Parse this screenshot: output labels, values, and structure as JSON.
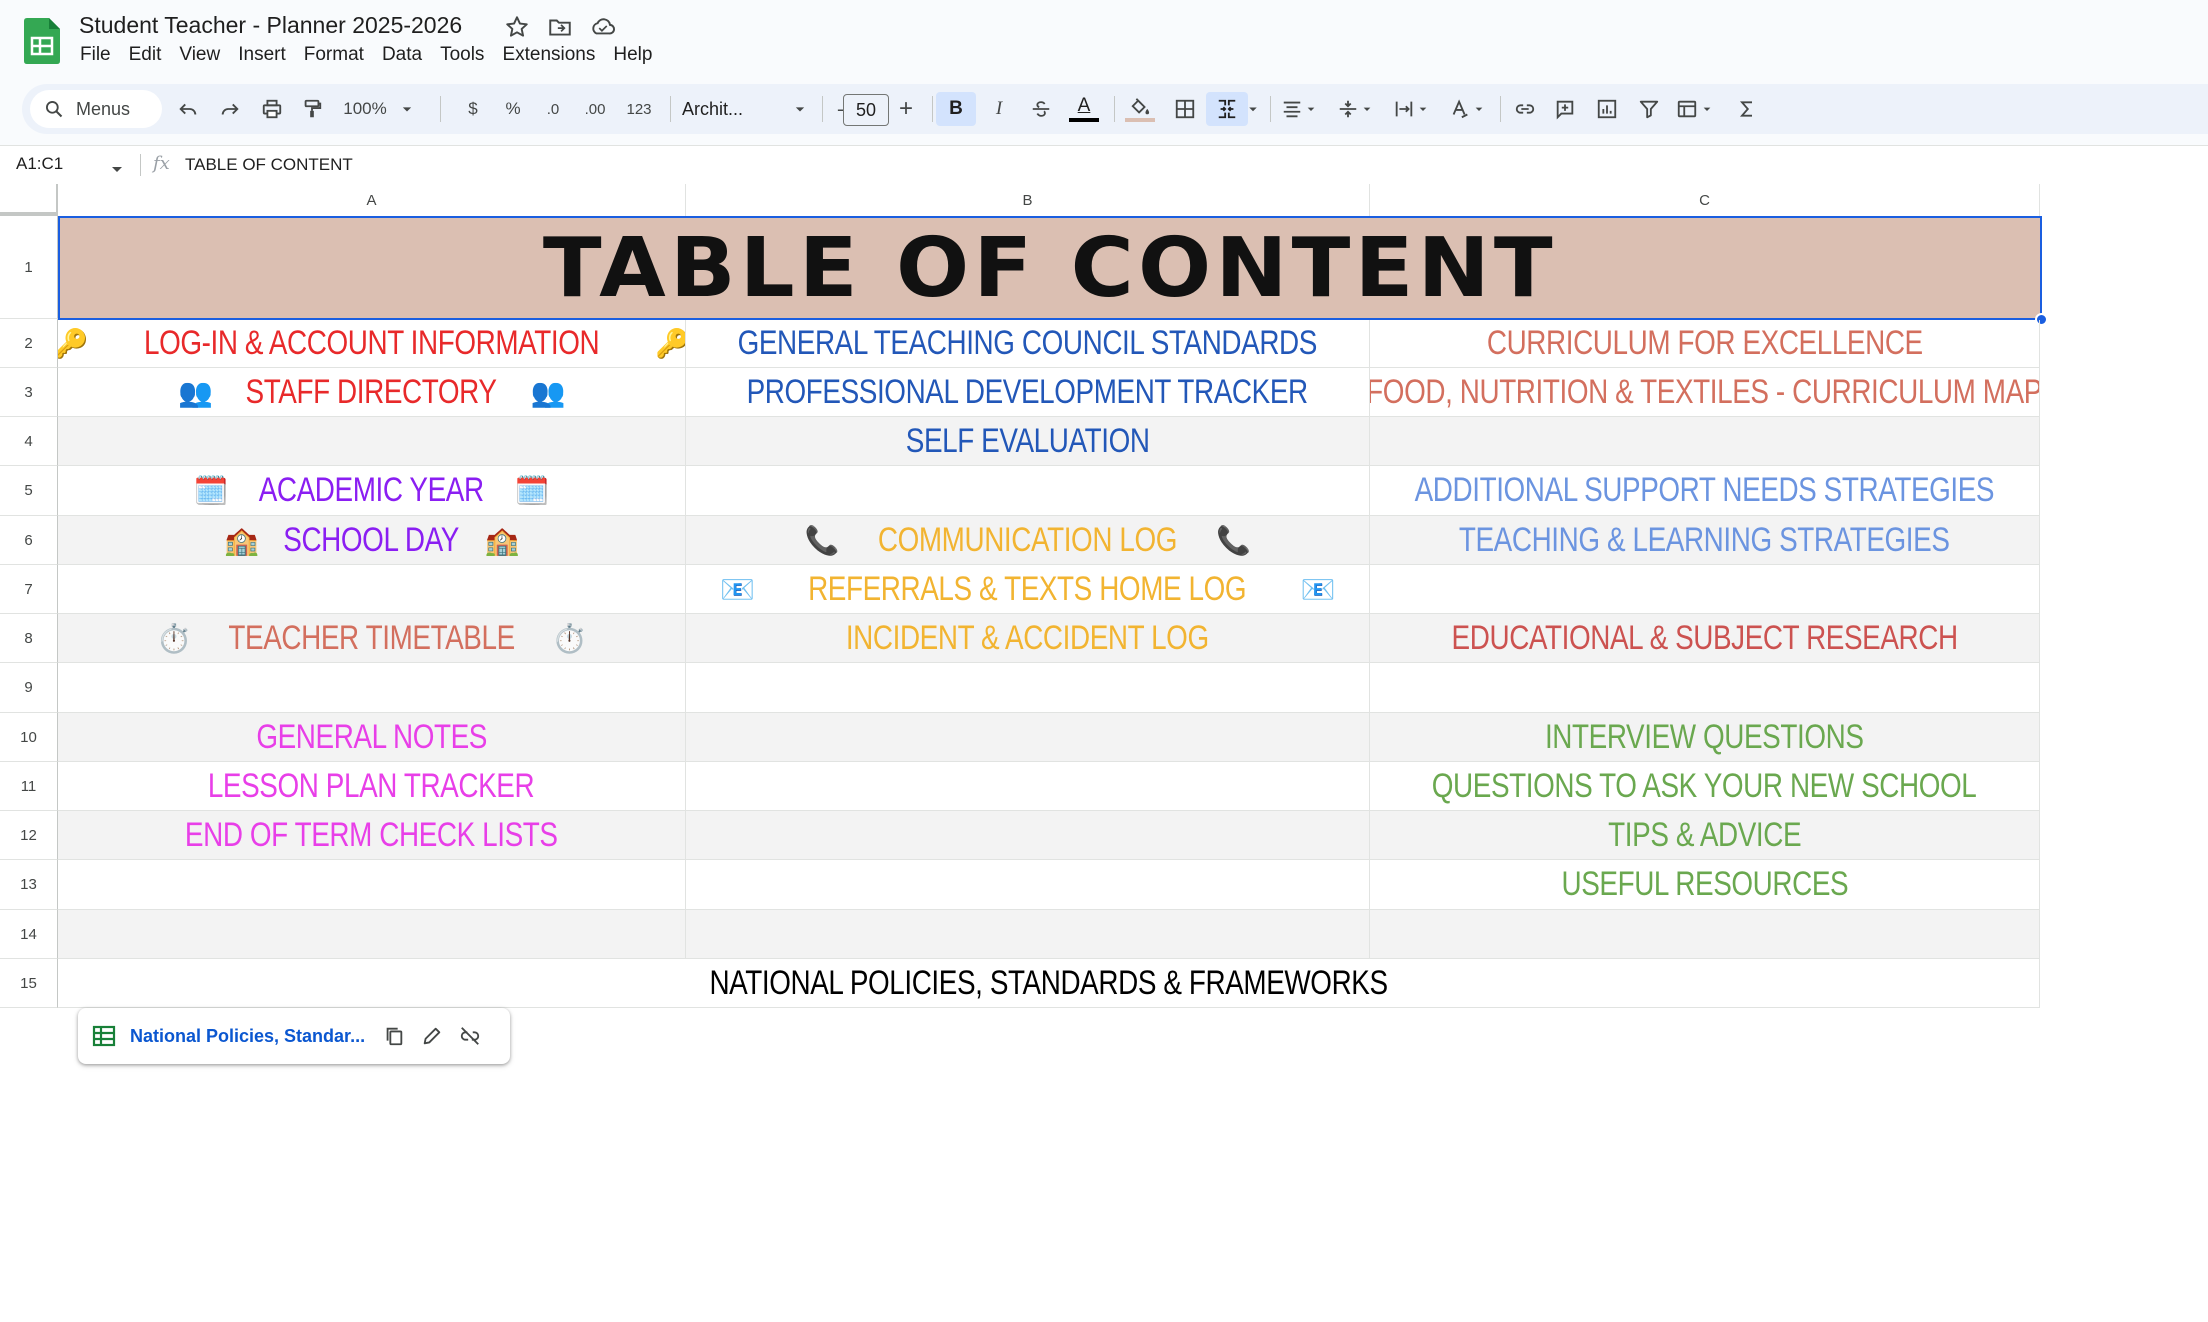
{
  "app": {
    "doc_title": "Student Teacher - Planner 2025-2026",
    "menus": [
      "File",
      "Edit",
      "View",
      "Insert",
      "Format",
      "Data",
      "Tools",
      "Extensions",
      "Help"
    ]
  },
  "toolbar": {
    "search_label": "Menus",
    "zoom": "100%",
    "currency": "$",
    "percent": "%",
    "decrease_decimal": ".0",
    "increase_decimal": ".00",
    "number_format": "123",
    "font": "Archit...",
    "font_size": "50",
    "minus": "–",
    "plus": "+",
    "bold": "B",
    "italic": "I",
    "text_color": "A",
    "text_color_bar": "#000000",
    "fill_color_bar": "#dbbfb2"
  },
  "formula_bar": {
    "name_box": "A1:C1",
    "fx": "fx",
    "content": "TABLE OF CONTENT"
  },
  "columns": [
    "A",
    "B",
    "C"
  ],
  "rows": [
    "1",
    "2",
    "3",
    "4",
    "5",
    "6",
    "7",
    "8",
    "9",
    "10",
    "11",
    "12",
    "13",
    "14",
    "15"
  ],
  "sheet": {
    "title": "TABLE OF CONTENT",
    "title_fill": "#dbbfb2",
    "cells": {
      "a2": "LOG-IN & ACCOUNT INFORMATION",
      "a3": "STAFF DIRECTORY",
      "a5": "ACADEMIC YEAR",
      "a6": "SCHOOL DAY",
      "a8": "TEACHER TIMETABLE",
      "a10": "GENERAL NOTES",
      "a11": "LESSON PLAN TRACKER",
      "a12": "END OF TERM CHECK LISTS",
      "b2": "GENERAL TEACHING COUNCIL STANDARDS",
      "b3": "PROFESSIONAL DEVELOPMENT TRACKER",
      "b4": "SELF EVALUATION",
      "b6": "COMMUNICATION LOG",
      "b7": "REFERRALS & TEXTS HOME LOG",
      "b8": "INCIDENT & ACCIDENT LOG",
      "c2": "CURRICULUM FOR EXCELLENCE",
      "c3": "FOOD, NUTRITION & TEXTILES - CURRICULUM MAP",
      "c5": "ADDITIONAL SUPPORT NEEDS STRATEGIES",
      "c6": "TEACHING & LEARNING STRATEGIES",
      "c8": "EDUCATIONAL & SUBJECT RESEARCH",
      "c10": "INTERVIEW QUESTIONS",
      "c11": "QUESTIONS TO ASK YOUR NEW SCHOOL",
      "c12": "TIPS & ADVICE",
      "c13": "USEFUL RESOURCES",
      "a15": "NATIONAL POLICIES, STANDARDS & FRAMEWORKS"
    },
    "emoji": {
      "key": "🔑",
      "people": "👥",
      "calendar": "🗓️",
      "school": "🏫",
      "phone": "📞",
      "envelope": "📧",
      "stopwatch": "⏱️"
    },
    "colors": {
      "red": "#e8292a",
      "blue": "#2257b8",
      "salmon": "#d36f5e",
      "purple": "#8a1ef2",
      "orange": "#f2b431",
      "light_blue": "#6b94e0",
      "brick": "#cc5250",
      "magenta": "#e83fe8",
      "green": "#6aa84f",
      "black": "#000000"
    }
  },
  "link_chip": {
    "text": "National Policies, Standar..."
  }
}
